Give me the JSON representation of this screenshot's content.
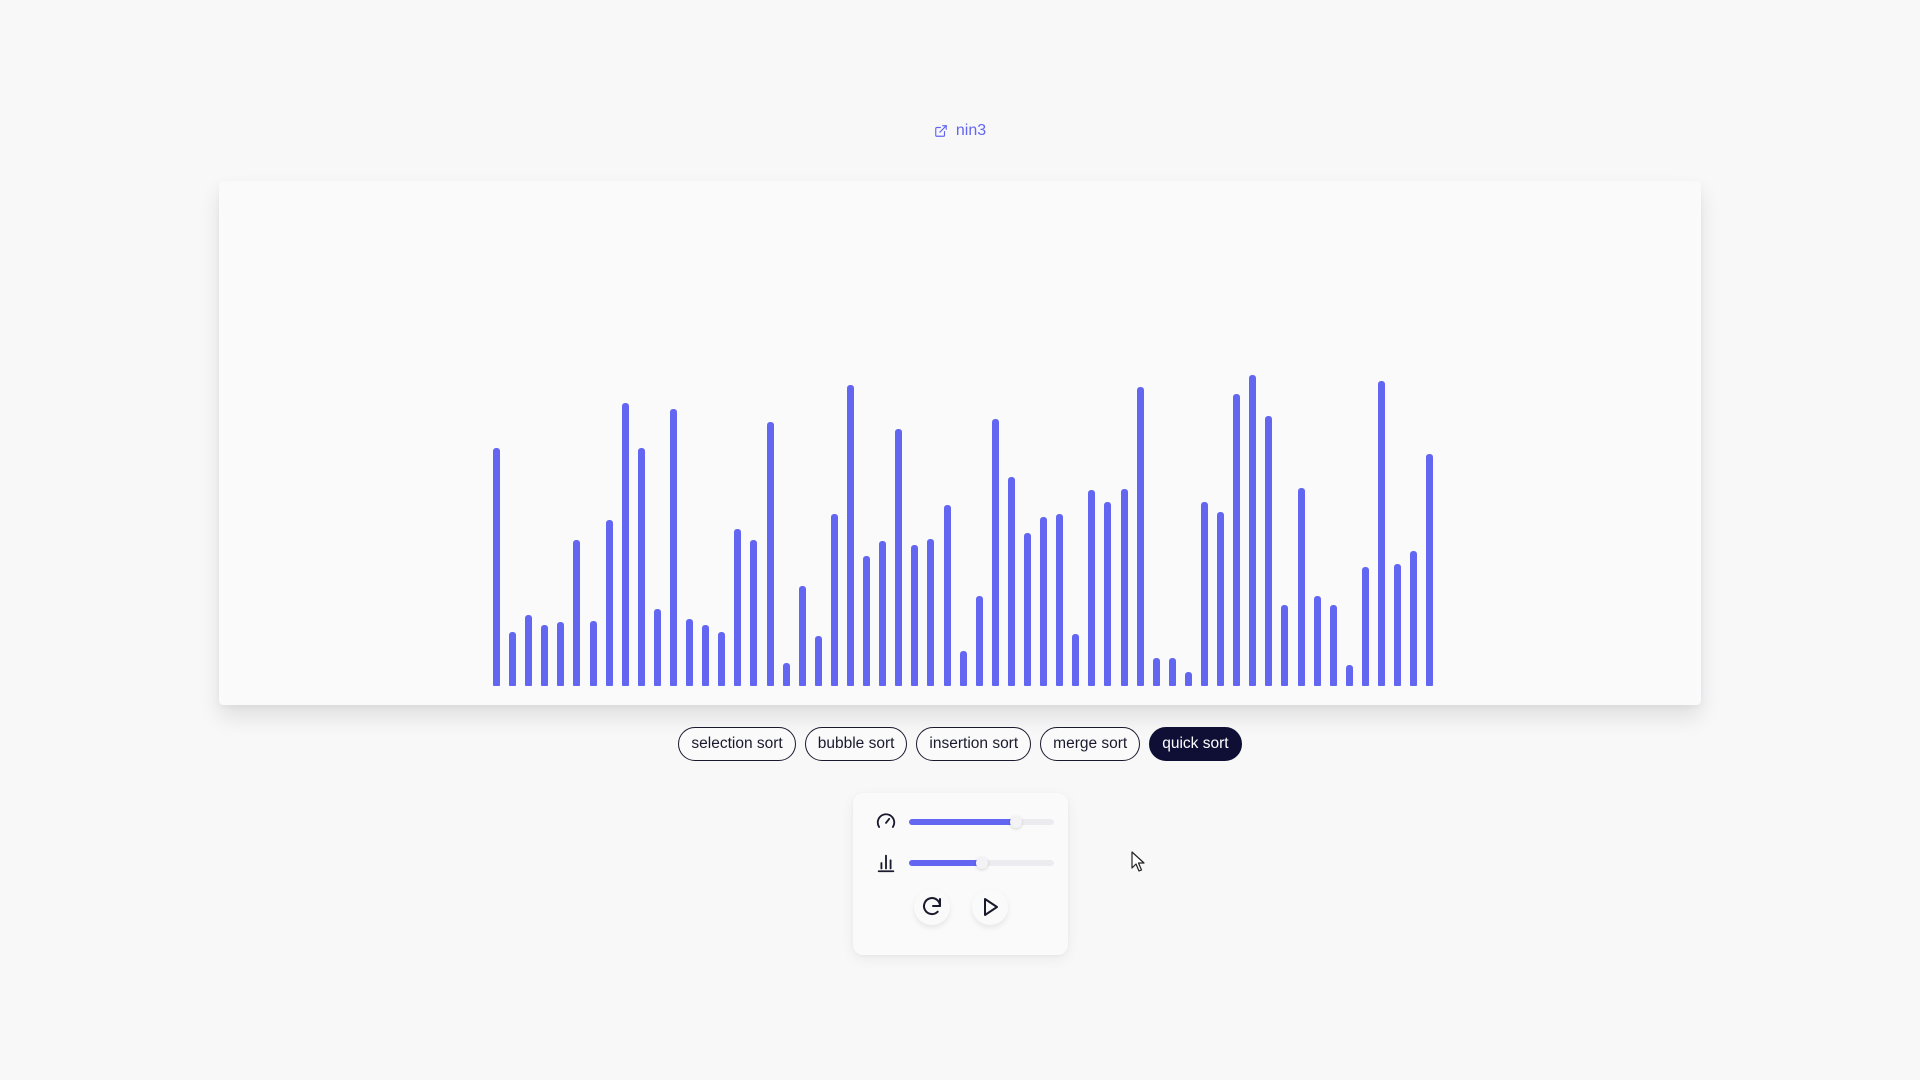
{
  "author": {
    "name": "nin3"
  },
  "visualizer": {
    "bar_color": "#6366f1",
    "values": [
      0.755,
      0.173,
      0.225,
      0.195,
      0.203,
      0.465,
      0.205,
      0.527,
      0.898,
      0.756,
      0.245,
      0.878,
      0.214,
      0.193,
      0.173,
      0.497,
      0.465,
      0.839,
      0.073,
      0.317,
      0.158,
      0.547,
      0.957,
      0.414,
      0.459,
      0.815,
      0.447,
      0.466,
      0.576,
      0.112,
      0.287,
      0.848,
      0.665,
      0.486,
      0.535,
      0.546,
      0.166,
      0.623,
      0.583,
      0.624,
      0.948,
      0.088,
      0.088,
      0.045,
      0.584,
      0.552,
      0.927,
      0.987,
      0.857,
      0.256,
      0.627,
      0.286,
      0.256,
      0.068,
      0.377,
      0.968,
      0.387,
      0.427,
      0.736
    ]
  },
  "algorithms": {
    "selection": "selection sort",
    "bubble": "bubble sort",
    "insertion": "insertion sort",
    "merge": "merge sort",
    "quick": "quick sort",
    "active": "quick sort"
  },
  "controls": {
    "speed_icon": "speedometer-icon",
    "speed_level": 0.74,
    "size_icon": "bar-chart-icon",
    "size_level": 0.5,
    "reset_icon": "reset-icon",
    "play_icon": "play-icon"
  }
}
